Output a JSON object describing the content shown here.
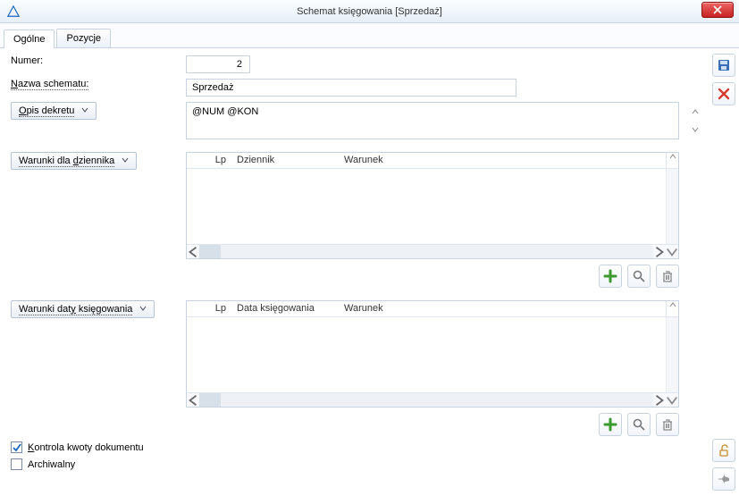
{
  "titlebar": {
    "title": "Schemat księgowania [Sprzedaż]"
  },
  "tabs": {
    "general": "Ogólne",
    "positions": "Pozycje"
  },
  "form": {
    "numer_label": "Numer:",
    "numer_value": "2",
    "nazwa_label": "Nazwa schematu:",
    "nazwa_value": "Sprzedaż",
    "opis_label": "Opis dekretu",
    "opis_value": "@NUM @KON"
  },
  "journal": {
    "section_label": "Warunki dla dziennika",
    "cols": {
      "lp": "Lp",
      "dziennik": "Dziennik",
      "warunek": "Warunek"
    }
  },
  "date": {
    "section_label": "Warunki daty księgowania",
    "cols": {
      "lp": "Lp",
      "data": "Data księgowania",
      "warunek": "Warunek"
    }
  },
  "checks": {
    "kontrola": "Kontrola kwoty dokumentu",
    "kontrola_checked": true,
    "archiwalny": "Archiwalny",
    "archiwalny_checked": false
  }
}
